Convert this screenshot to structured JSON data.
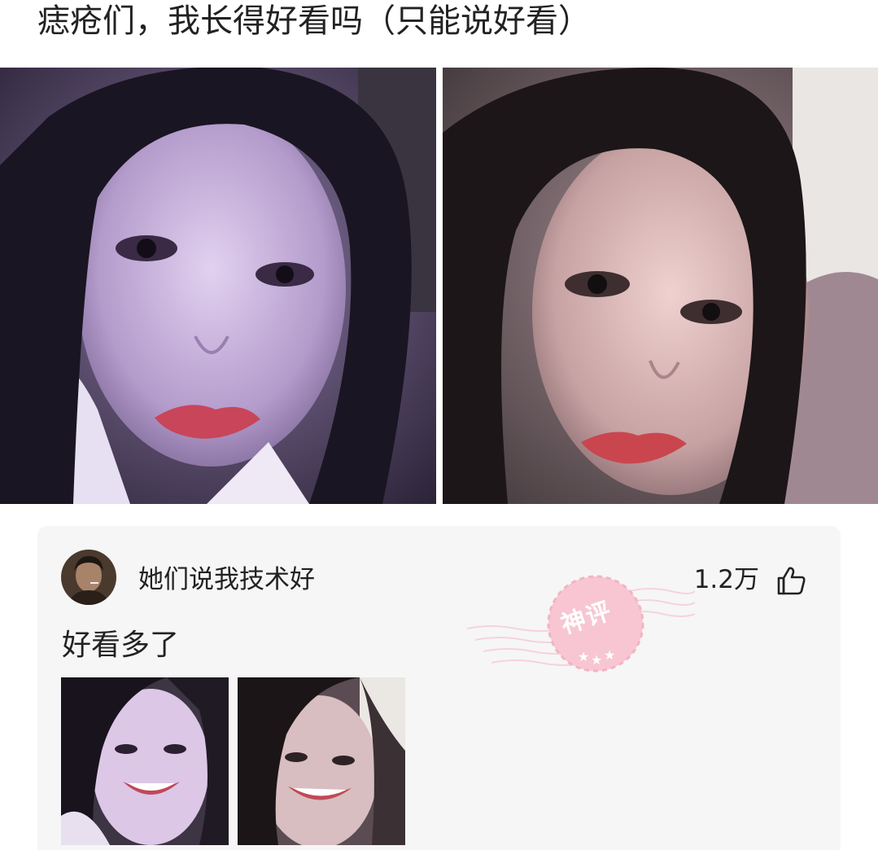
{
  "post": {
    "title": "痣疮们，我长得好看吗（只能说好看）",
    "images": [
      {
        "alt": "photo-1"
      },
      {
        "alt": "photo-2"
      }
    ]
  },
  "comment": {
    "username": "她们说我技术好",
    "likes": "1.2万",
    "badge": "神评",
    "text": "好看多了",
    "images": [
      {
        "alt": "comment-photo-1"
      },
      {
        "alt": "comment-photo-2"
      }
    ]
  },
  "icons": {
    "like": "thumbs-up-icon",
    "badge": "stamp-badge-icon"
  },
  "colors": {
    "badge_pink": "#f7c6d2",
    "text": "#222222",
    "card_bg": "#f6f6f6"
  }
}
